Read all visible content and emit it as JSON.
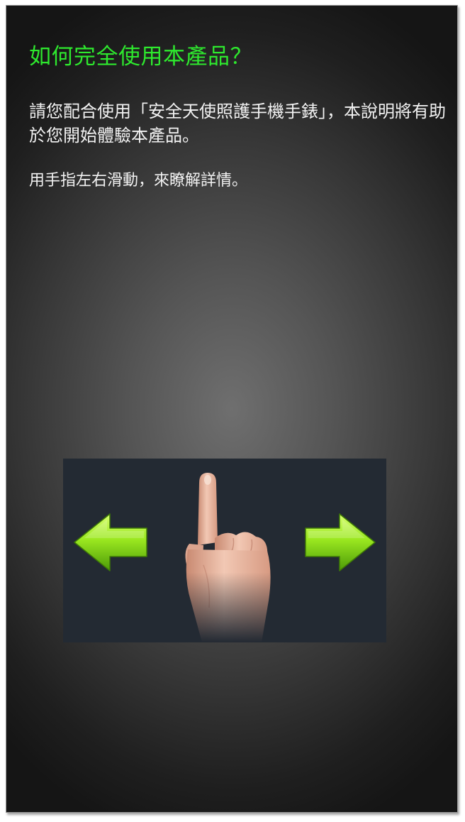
{
  "intro_page": {
    "title": "如何完全使用本產品？",
    "intro_text": "請您配合使用「安全天使照護手機手錶」，本說明將有助於您開始體驗本產品。",
    "hint_text": "用手指左右滑動，來瞭解詳情。"
  },
  "illustration": {
    "icons": [
      "arrow-left-icon",
      "pointing-finger-icon",
      "arrow-right-icon"
    ],
    "arrow_color": "#8fe81a",
    "panel_color": "#232a33"
  }
}
